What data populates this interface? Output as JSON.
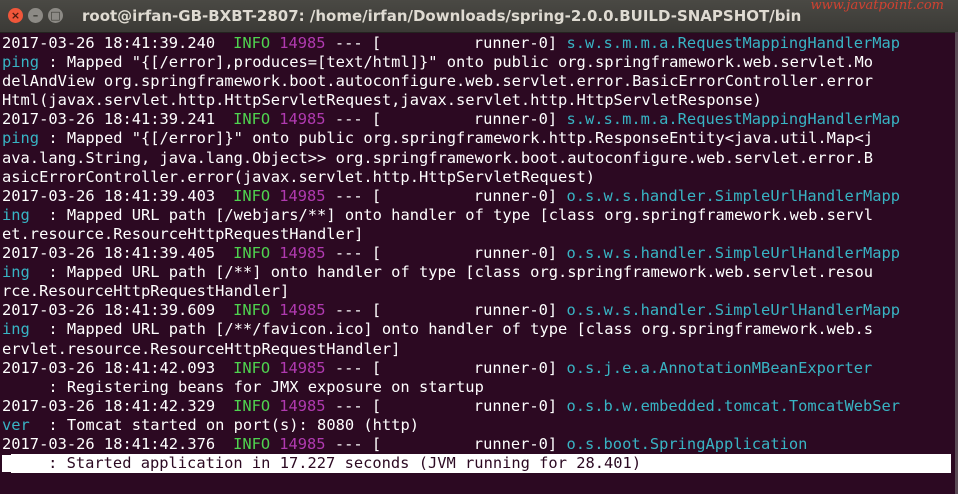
{
  "window": {
    "title": "root@irfan-GB-BXBT-2807: /home/irfan/Downloads/spring-2.0.0.BUILD-SNAPSHOT/bin",
    "buttons": {
      "close": "×",
      "minimize": "–",
      "maximize": "□"
    },
    "watermark": "www.javatpoint.com"
  },
  "colors": {
    "background": "#2c0922",
    "info": "#4fd34f",
    "pid": "#b03ab0",
    "logger": "#38b4c4"
  },
  "terminal": {
    "lines": [
      {
        "ts": "2017-03-26 18:41:39.240",
        "level": "INFO",
        "pid": "14985",
        "thread": " --- [          runner-0] ",
        "logger": "s.w.s.m.m.a.RequestMappingHandlerMap"
      },
      {
        "logger": "ping",
        "msg": " : Mapped \"{[/error],produces=[text/html]}\" onto public org.springframework.web.servlet.Mo"
      },
      {
        "msg": "delAndView org.springframework.boot.autoconfigure.web.servlet.error.BasicErrorController.error"
      },
      {
        "msg": "Html(javax.servlet.http.HttpServletRequest,javax.servlet.http.HttpServletResponse)"
      },
      {
        "ts": "2017-03-26 18:41:39.241",
        "level": "INFO",
        "pid": "14985",
        "thread": " --- [          runner-0] ",
        "logger": "s.w.s.m.m.a.RequestMappingHandlerMap"
      },
      {
        "logger": "ping",
        "msg": " : Mapped \"{[/error]}\" onto public org.springframework.http.ResponseEntity<java.util.Map<j"
      },
      {
        "msg": "ava.lang.String, java.lang.Object>> org.springframework.boot.autoconfigure.web.servlet.error.B"
      },
      {
        "msg": "asicErrorController.error(javax.servlet.http.HttpServletRequest)"
      },
      {
        "ts": "2017-03-26 18:41:39.403",
        "level": "INFO",
        "pid": "14985",
        "thread": " --- [          runner-0] ",
        "logger": "o.s.w.s.handler.SimpleUrlHandlerMapp"
      },
      {
        "logger": "ing",
        "msg": "  : Mapped URL path [/webjars/**] onto handler of type [class org.springframework.web.servl"
      },
      {
        "msg": "et.resource.ResourceHttpRequestHandler]"
      },
      {
        "ts": "2017-03-26 18:41:39.405",
        "level": "INFO",
        "pid": "14985",
        "thread": " --- [          runner-0] ",
        "logger": "o.s.w.s.handler.SimpleUrlHandlerMapp"
      },
      {
        "logger": "ing",
        "msg": "  : Mapped URL path [/**] onto handler of type [class org.springframework.web.servlet.resou"
      },
      {
        "msg": "rce.ResourceHttpRequestHandler]"
      },
      {
        "ts": "2017-03-26 18:41:39.609",
        "level": "INFO",
        "pid": "14985",
        "thread": " --- [          runner-0] ",
        "logger": "o.s.w.s.handler.SimpleUrlHandlerMapp"
      },
      {
        "logger": "ing",
        "msg": "  : Mapped URL path [/**/favicon.ico] onto handler of type [class org.springframework.web.s"
      },
      {
        "msg": "ervlet.resource.ResourceHttpRequestHandler]"
      },
      {
        "ts": "2017-03-26 18:41:42.093",
        "level": "INFO",
        "pid": "14985",
        "thread": " --- [          runner-0] ",
        "logger": "o.s.j.e.a.AnnotationMBeanExporter"
      },
      {
        "msg": "     : Registering beans for JMX exposure on startup"
      },
      {
        "ts": "2017-03-26 18:41:42.329",
        "level": "INFO",
        "pid": "14985",
        "thread": " --- [          runner-0] ",
        "logger": "o.s.b.w.embedded.tomcat.TomcatWebSer"
      },
      {
        "logger": "ver",
        "msg": "  : Tomcat started on port(s): 8080 (http)"
      },
      {
        "ts": "2017-03-26 18:41:42.376",
        "level": "INFO",
        "pid": "14985",
        "thread": " --- [          runner-0] ",
        "logger": "o.s.boot.SpringApplication"
      }
    ],
    "highlighted": "    : Started application in 17.227 seconds (JVM running for 28.401)"
  }
}
